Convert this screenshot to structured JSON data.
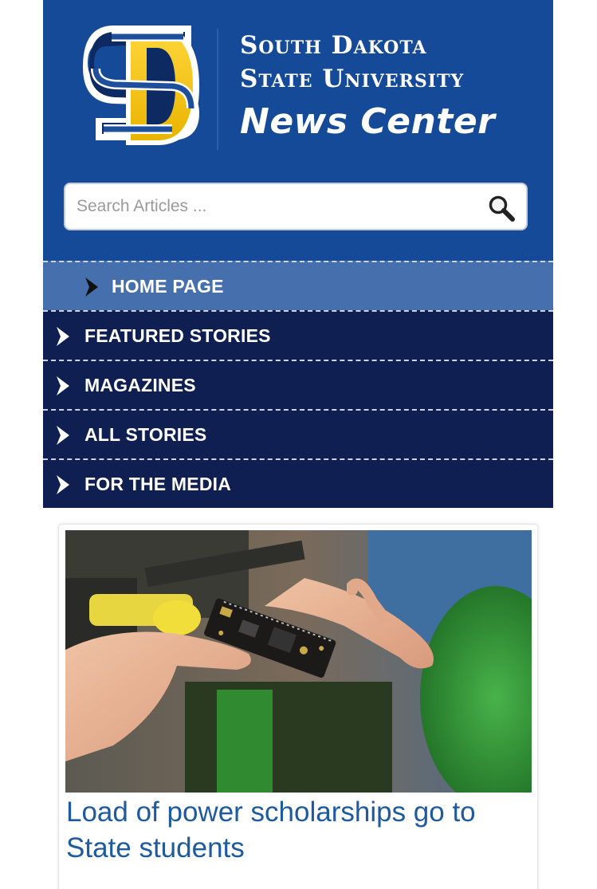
{
  "brand": {
    "line1": "South Dakota",
    "line2": "State University",
    "line3": "News Center",
    "colors": {
      "primary_blue": "#154a99",
      "navy": "#0f1f52",
      "gold": "#f5c518",
      "active_nav": "#4670ad",
      "link_blue": "#1d5aa0"
    }
  },
  "search": {
    "placeholder": "Search Articles ...",
    "icon": "magnifier-icon"
  },
  "nav": {
    "items": [
      {
        "label": "HOME PAGE",
        "active": true
      },
      {
        "label": "FEATURED STORIES",
        "active": false
      },
      {
        "label": "MAGAZINES",
        "active": false
      },
      {
        "label": "ALL STORIES",
        "active": false
      },
      {
        "label": "FOR THE MEDIA",
        "active": false
      }
    ]
  },
  "article": {
    "headline": "Load of power scholarships go to State students"
  }
}
